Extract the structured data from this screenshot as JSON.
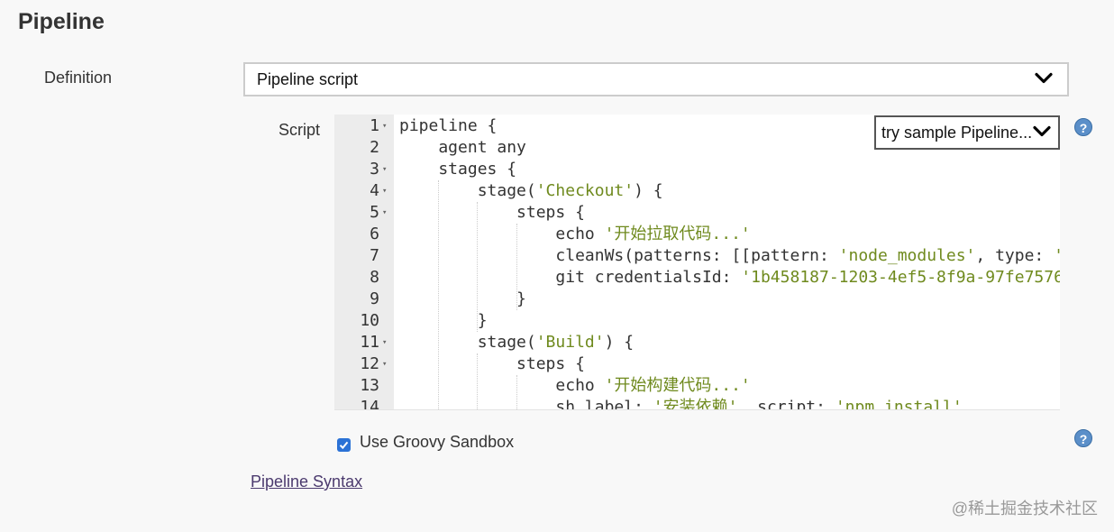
{
  "section": {
    "title": "Pipeline"
  },
  "definition": {
    "label": "Definition",
    "value": "Pipeline script",
    "icon": "chevron-down-icon"
  },
  "script": {
    "label": "Script",
    "sample_select": {
      "value": "try sample Pipeline...",
      "icon": "chevron-down-icon"
    },
    "lines": [
      {
        "num": "1",
        "fold": true,
        "segments": [
          {
            "t": "pipeline {"
          }
        ]
      },
      {
        "num": "2",
        "fold": false,
        "segments": [
          {
            "t": "    agent any"
          }
        ]
      },
      {
        "num": "3",
        "fold": true,
        "segments": [
          {
            "t": "    stages {"
          }
        ]
      },
      {
        "num": "4",
        "fold": true,
        "segments": [
          {
            "t": "        stage("
          },
          {
            "t": "'Checkout'",
            "s": true
          },
          {
            "t": ") {"
          }
        ]
      },
      {
        "num": "5",
        "fold": true,
        "segments": [
          {
            "t": "            steps {"
          }
        ]
      },
      {
        "num": "6",
        "fold": false,
        "segments": [
          {
            "t": "                echo "
          },
          {
            "t": "'开始拉取代码...'",
            "s": true
          }
        ]
      },
      {
        "num": "7",
        "fold": false,
        "segments": [
          {
            "t": "                cleanWs(patterns: [[pattern: "
          },
          {
            "t": "'node_modules'",
            "s": true
          },
          {
            "t": ", type: "
          },
          {
            "t": "'",
            "s": true
          }
        ]
      },
      {
        "num": "8",
        "fold": false,
        "segments": [
          {
            "t": "                git credentialsId: "
          },
          {
            "t": "'1b458187-1203-4ef5-8f9a-97fe7576",
            "s": true
          }
        ]
      },
      {
        "num": "9",
        "fold": false,
        "segments": [
          {
            "t": "            }"
          }
        ]
      },
      {
        "num": "10",
        "fold": false,
        "segments": [
          {
            "t": "        }"
          }
        ]
      },
      {
        "num": "11",
        "fold": true,
        "segments": [
          {
            "t": "        stage("
          },
          {
            "t": "'Build'",
            "s": true
          },
          {
            "t": ") {"
          }
        ]
      },
      {
        "num": "12",
        "fold": true,
        "segments": [
          {
            "t": "            steps {"
          }
        ]
      },
      {
        "num": "13",
        "fold": false,
        "segments": [
          {
            "t": "                echo "
          },
          {
            "t": "'开始构建代码...'",
            "s": true
          }
        ]
      },
      {
        "num": "14",
        "fold": false,
        "segments": [
          {
            "t": "                sh label: "
          },
          {
            "t": "'安装依赖'",
            "s": true
          },
          {
            "t": ", script: "
          },
          {
            "t": "'npm install'",
            "s": true
          }
        ]
      }
    ]
  },
  "sandbox": {
    "label": "Use Groovy Sandbox",
    "checked": true
  },
  "syntax_link": {
    "label": "Pipeline Syntax"
  },
  "help": {
    "glyph": "?"
  },
  "watermark": {
    "text": "@稀土掘金技术社区"
  },
  "colors": {
    "string": "#6f8a1e",
    "checkbox": "#2b72d6",
    "help": "#5b8fc9"
  }
}
